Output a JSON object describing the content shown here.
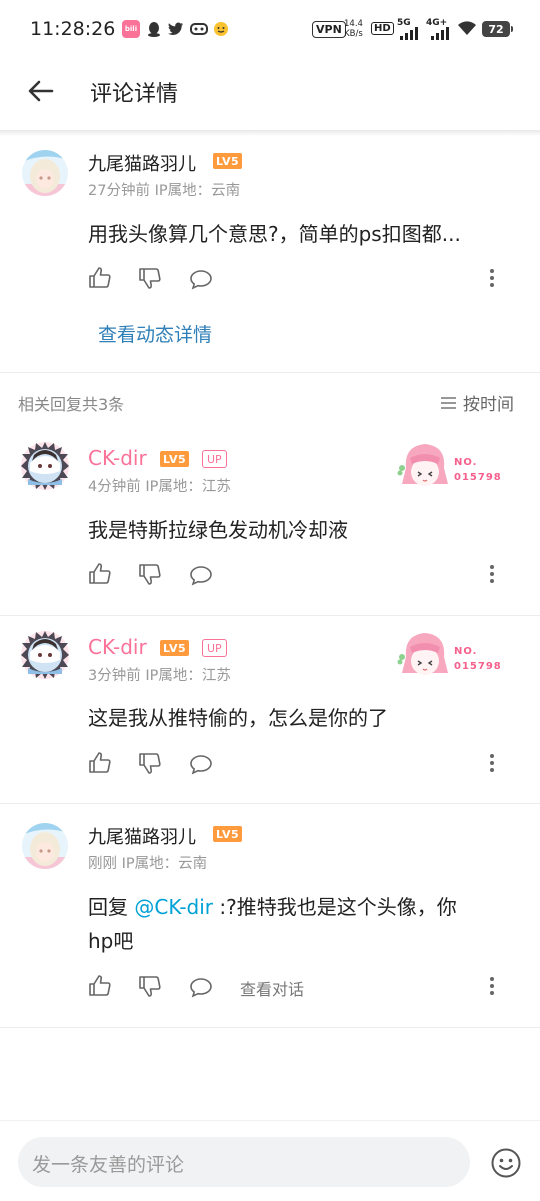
{
  "status_bar": {
    "time": "11:28:26",
    "vpn": "VPN",
    "net_speed": "14.4",
    "net_unit": "KB/s",
    "hd": "HD",
    "net1": "5G",
    "net2": "4G+",
    "battery": "72"
  },
  "header": {
    "title": "评论详情"
  },
  "root_comment": {
    "username": "九尾猫路羽儿",
    "level": "LV5",
    "time": "27分钟前",
    "location": "IP属地：云南",
    "content": "用我头像算几个意思?，简单的ps扣图都...",
    "detail_link": "查看动态详情"
  },
  "replies_header": {
    "count_label": "相关回复共3条",
    "sort_label": "按时间"
  },
  "replies": [
    {
      "username": "CK-dir",
      "level": "LV5",
      "up": "UP",
      "time": "4分钟前",
      "location": "IP属地：江苏",
      "content": "我是特斯拉绿色发动机冷却液",
      "fan_no": "NO.",
      "fan_id": "015798"
    },
    {
      "username": "CK-dir",
      "level": "LV5",
      "up": "UP",
      "time": "3分钟前",
      "location": "IP属地：江苏",
      "content": "这是我从推特偷的，怎么是你的了",
      "fan_no": "NO.",
      "fan_id": "015798"
    },
    {
      "username": "九尾猫路羽儿",
      "level": "LV5",
      "time": "刚刚",
      "location": "IP属地：云南",
      "reply_prefix": "回复 ",
      "mention": "@CK-dir",
      "content_line1": " :?推特我也是这个头像，你",
      "content_line2": "hp吧",
      "view_dialog": "查看对话"
    }
  ],
  "input": {
    "placeholder": "发一条友善的评论"
  },
  "colors": {
    "brand_pink": "#fb7299",
    "link_blue": "#00a1d6",
    "level_orange": "#ff9a3d"
  }
}
